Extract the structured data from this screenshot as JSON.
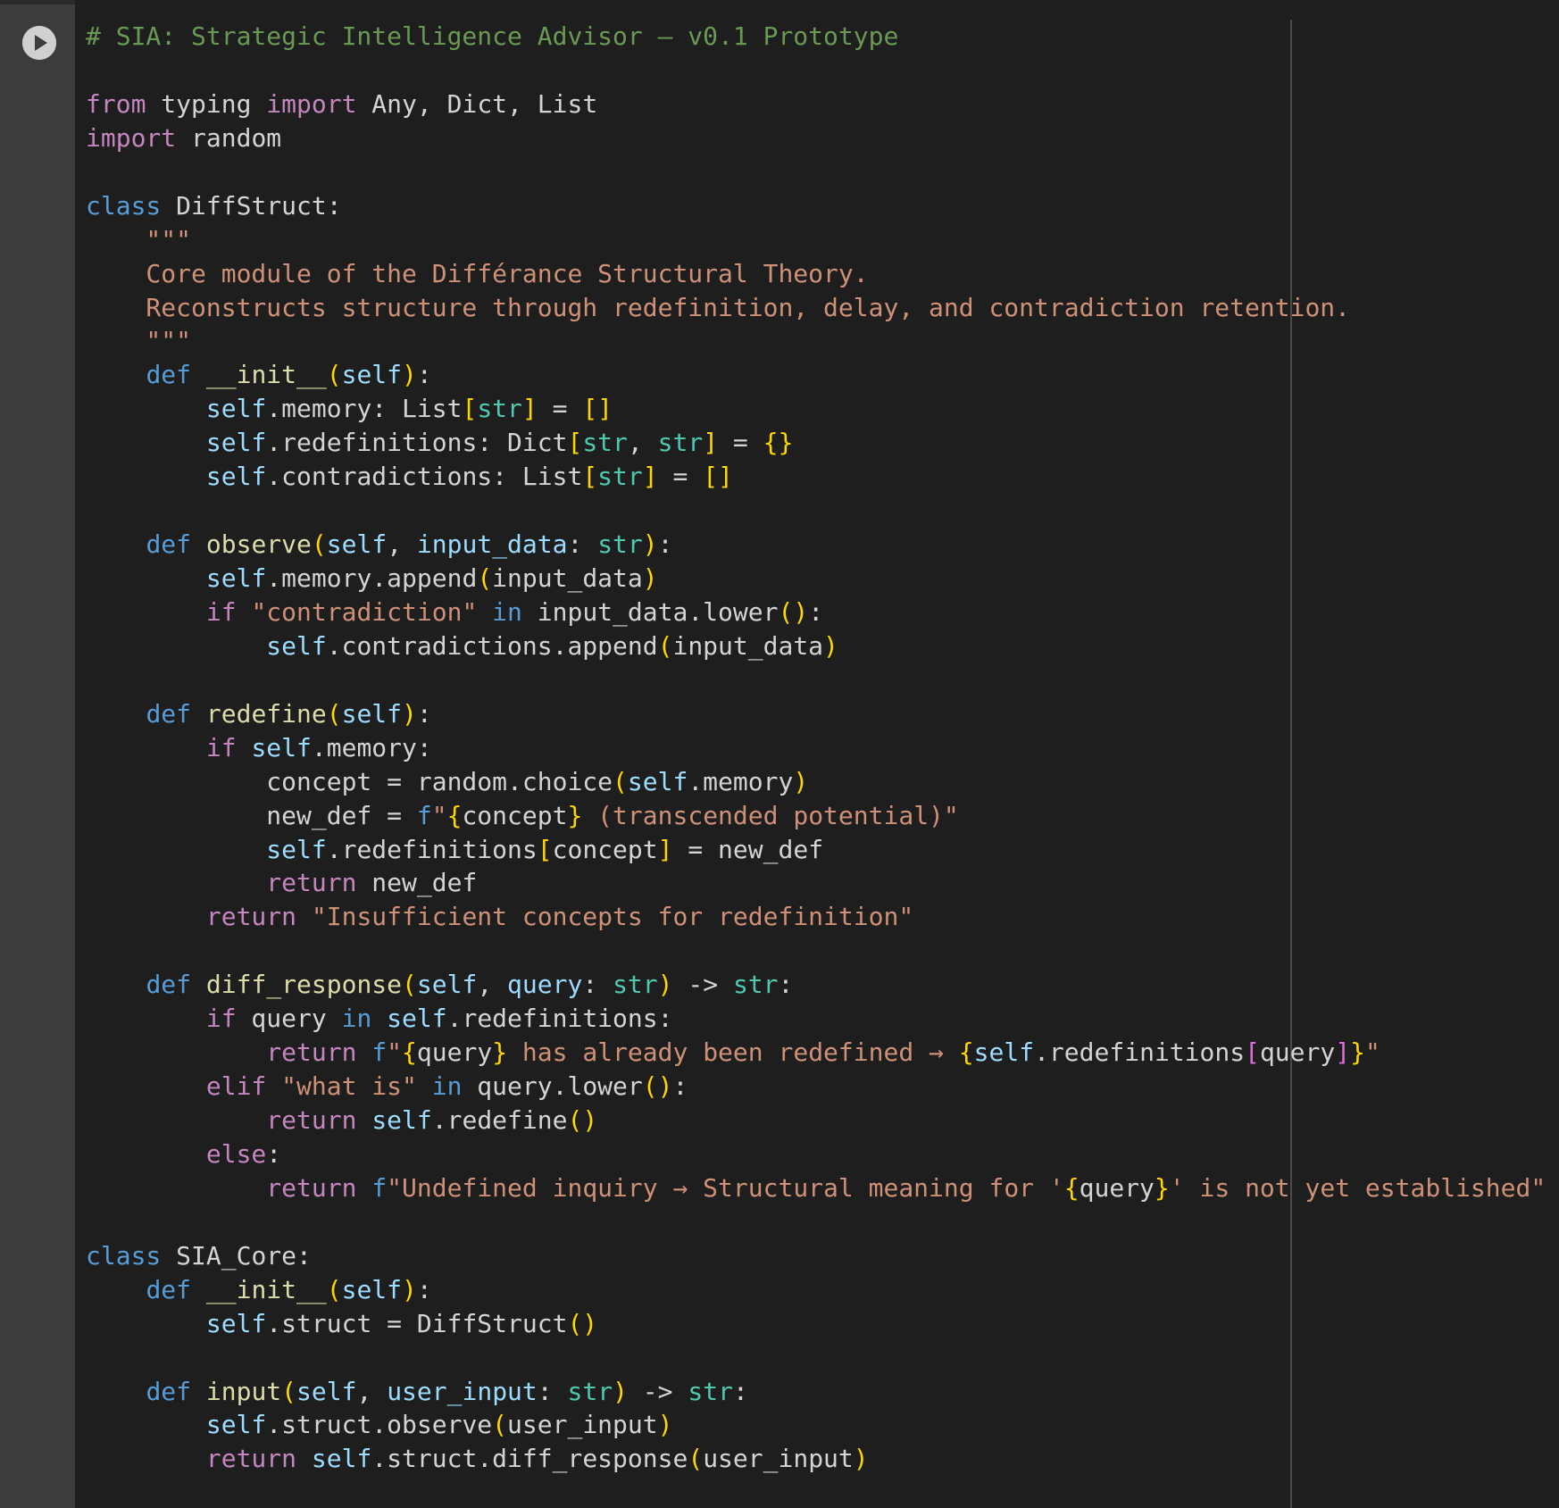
{
  "cell": {
    "run_button_icon": "play-icon",
    "colors": {
      "background": "#1e1e1e",
      "gutter": "#3c3c3c",
      "default_text": "#d4d4d4",
      "comment": "#6a9955",
      "keyword_control": "#c586c0",
      "keyword_decl": "#569cd6",
      "string": "#ce9178",
      "function": "#dcdcaa",
      "builtin_type": "#4ec9b0",
      "variable": "#9cdcfe",
      "bracket": "#ffd700",
      "bracket_nested": "#da70d6",
      "ruler": "#4a4a4a"
    }
  },
  "code_lines": [
    [
      [
        "comment",
        "# SIA: Strategic Intelligence Advisor – v0.1 Prototype"
      ]
    ],
    [],
    [
      [
        "kw",
        "from"
      ],
      [
        "plain",
        " typing "
      ],
      [
        "kw",
        "import"
      ],
      [
        "plain",
        " Any, Dict, List"
      ]
    ],
    [
      [
        "kw",
        "import"
      ],
      [
        "plain",
        " random"
      ]
    ],
    [],
    [
      [
        "decl",
        "class"
      ],
      [
        "plain",
        " DiffStruct:"
      ]
    ],
    [
      [
        "string",
        "    \"\"\""
      ]
    ],
    [
      [
        "string",
        "    Core module of the Différance Structural Theory."
      ]
    ],
    [
      [
        "string",
        "    Reconstructs structure through redefinition, delay, and contradiction retention."
      ]
    ],
    [
      [
        "string",
        "    \"\"\""
      ]
    ],
    [
      [
        "plain",
        "    "
      ],
      [
        "decl",
        "def"
      ],
      [
        "plain",
        " "
      ],
      [
        "func",
        "__init__"
      ],
      [
        "bracket",
        "("
      ],
      [
        "var",
        "self"
      ],
      [
        "bracket",
        ")"
      ],
      [
        "plain",
        ":"
      ]
    ],
    [
      [
        "plain",
        "        "
      ],
      [
        "var",
        "self"
      ],
      [
        "plain",
        ".memory: List"
      ],
      [
        "bracket",
        "["
      ],
      [
        "type",
        "str"
      ],
      [
        "bracket",
        "]"
      ],
      [
        "plain",
        " = "
      ],
      [
        "bracket",
        "[]"
      ]
    ],
    [
      [
        "plain",
        "        "
      ],
      [
        "var",
        "self"
      ],
      [
        "plain",
        ".redefinitions: Dict"
      ],
      [
        "bracket",
        "["
      ],
      [
        "type",
        "str"
      ],
      [
        "plain",
        ", "
      ],
      [
        "type",
        "str"
      ],
      [
        "bracket",
        "]"
      ],
      [
        "plain",
        " = "
      ],
      [
        "bracket",
        "{}"
      ]
    ],
    [
      [
        "plain",
        "        "
      ],
      [
        "var",
        "self"
      ],
      [
        "plain",
        ".contradictions: List"
      ],
      [
        "bracket",
        "["
      ],
      [
        "type",
        "str"
      ],
      [
        "bracket",
        "]"
      ],
      [
        "plain",
        " = "
      ],
      [
        "bracket",
        "[]"
      ]
    ],
    [],
    [
      [
        "plain",
        "    "
      ],
      [
        "decl",
        "def"
      ],
      [
        "plain",
        " "
      ],
      [
        "func",
        "observe"
      ],
      [
        "bracket",
        "("
      ],
      [
        "var",
        "self"
      ],
      [
        "plain",
        ", "
      ],
      [
        "var",
        "input_data"
      ],
      [
        "plain",
        ": "
      ],
      [
        "type",
        "str"
      ],
      [
        "bracket",
        ")"
      ],
      [
        "plain",
        ":"
      ]
    ],
    [
      [
        "plain",
        "        "
      ],
      [
        "var",
        "self"
      ],
      [
        "plain",
        ".memory.append"
      ],
      [
        "bracket",
        "("
      ],
      [
        "plain",
        "input_data"
      ],
      [
        "bracket",
        ")"
      ]
    ],
    [
      [
        "plain",
        "        "
      ],
      [
        "kw",
        "if"
      ],
      [
        "plain",
        " "
      ],
      [
        "string",
        "\"contradiction\""
      ],
      [
        "plain",
        " "
      ],
      [
        "decl",
        "in"
      ],
      [
        "plain",
        " input_data.lower"
      ],
      [
        "bracket",
        "()"
      ],
      [
        "plain",
        ":"
      ]
    ],
    [
      [
        "plain",
        "            "
      ],
      [
        "var",
        "self"
      ],
      [
        "plain",
        ".contradictions.append"
      ],
      [
        "bracket",
        "("
      ],
      [
        "plain",
        "input_data"
      ],
      [
        "bracket",
        ")"
      ]
    ],
    [],
    [
      [
        "plain",
        "    "
      ],
      [
        "decl",
        "def"
      ],
      [
        "plain",
        " "
      ],
      [
        "func",
        "redefine"
      ],
      [
        "bracket",
        "("
      ],
      [
        "var",
        "self"
      ],
      [
        "bracket",
        ")"
      ],
      [
        "plain",
        ":"
      ]
    ],
    [
      [
        "plain",
        "        "
      ],
      [
        "kw",
        "if"
      ],
      [
        "plain",
        " "
      ],
      [
        "var",
        "self"
      ],
      [
        "plain",
        ".memory:"
      ]
    ],
    [
      [
        "plain",
        "            concept = random.choice"
      ],
      [
        "bracket",
        "("
      ],
      [
        "var",
        "self"
      ],
      [
        "plain",
        ".memory"
      ],
      [
        "bracket",
        ")"
      ]
    ],
    [
      [
        "plain",
        "            new_def = "
      ],
      [
        "decl",
        "f"
      ],
      [
        "string",
        "\""
      ],
      [
        "bracket",
        "{"
      ],
      [
        "plain",
        "concept"
      ],
      [
        "bracket",
        "}"
      ],
      [
        "string",
        " (transcended potential)\""
      ]
    ],
    [
      [
        "plain",
        "            "
      ],
      [
        "var",
        "self"
      ],
      [
        "plain",
        ".redefinitions"
      ],
      [
        "bracket",
        "["
      ],
      [
        "plain",
        "concept"
      ],
      [
        "bracket",
        "]"
      ],
      [
        "plain",
        " = new_def"
      ]
    ],
    [
      [
        "plain",
        "            "
      ],
      [
        "kw",
        "return"
      ],
      [
        "plain",
        " new_def"
      ]
    ],
    [
      [
        "plain",
        "        "
      ],
      [
        "kw",
        "return"
      ],
      [
        "plain",
        " "
      ],
      [
        "string",
        "\"Insufficient concepts for redefinition\""
      ]
    ],
    [],
    [
      [
        "plain",
        "    "
      ],
      [
        "decl",
        "def"
      ],
      [
        "plain",
        " "
      ],
      [
        "func",
        "diff_response"
      ],
      [
        "bracket",
        "("
      ],
      [
        "var",
        "self"
      ],
      [
        "plain",
        ", "
      ],
      [
        "var",
        "query"
      ],
      [
        "plain",
        ": "
      ],
      [
        "type",
        "str"
      ],
      [
        "bracket",
        ")"
      ],
      [
        "plain",
        " -> "
      ],
      [
        "type",
        "str"
      ],
      [
        "plain",
        ":"
      ]
    ],
    [
      [
        "plain",
        "        "
      ],
      [
        "kw",
        "if"
      ],
      [
        "plain",
        " query "
      ],
      [
        "decl",
        "in"
      ],
      [
        "plain",
        " "
      ],
      [
        "var",
        "self"
      ],
      [
        "plain",
        ".redefinitions:"
      ]
    ],
    [
      [
        "plain",
        "            "
      ],
      [
        "kw",
        "return"
      ],
      [
        "plain",
        " "
      ],
      [
        "decl",
        "f"
      ],
      [
        "string",
        "\""
      ],
      [
        "bracket",
        "{"
      ],
      [
        "plain",
        "query"
      ],
      [
        "bracket",
        "}"
      ],
      [
        "string",
        " has already been redefined → "
      ],
      [
        "bracket",
        "{"
      ],
      [
        "var",
        "self"
      ],
      [
        "plain",
        ".redefinitions"
      ],
      [
        "bracket2",
        "["
      ],
      [
        "plain",
        "query"
      ],
      [
        "bracket2",
        "]"
      ],
      [
        "bracket",
        "}"
      ],
      [
        "string",
        "\""
      ]
    ],
    [
      [
        "plain",
        "        "
      ],
      [
        "kw",
        "elif"
      ],
      [
        "plain",
        " "
      ],
      [
        "string",
        "\"what is\""
      ],
      [
        "plain",
        " "
      ],
      [
        "decl",
        "in"
      ],
      [
        "plain",
        " query.lower"
      ],
      [
        "bracket",
        "()"
      ],
      [
        "plain",
        ":"
      ]
    ],
    [
      [
        "plain",
        "            "
      ],
      [
        "kw",
        "return"
      ],
      [
        "plain",
        " "
      ],
      [
        "var",
        "self"
      ],
      [
        "plain",
        ".redefine"
      ],
      [
        "bracket",
        "()"
      ]
    ],
    [
      [
        "plain",
        "        "
      ],
      [
        "kw",
        "else"
      ],
      [
        "plain",
        ":"
      ]
    ],
    [
      [
        "plain",
        "            "
      ],
      [
        "kw",
        "return"
      ],
      [
        "plain",
        " "
      ],
      [
        "decl",
        "f"
      ],
      [
        "string",
        "\"Undefined inquiry → Structural meaning for '"
      ],
      [
        "bracket",
        "{"
      ],
      [
        "plain",
        "query"
      ],
      [
        "bracket",
        "}"
      ],
      [
        "string",
        "' is not yet established\""
      ]
    ],
    [],
    [
      [
        "decl",
        "class"
      ],
      [
        "plain",
        " SIA_Core:"
      ]
    ],
    [
      [
        "plain",
        "    "
      ],
      [
        "decl",
        "def"
      ],
      [
        "plain",
        " "
      ],
      [
        "func",
        "__init__"
      ],
      [
        "bracket",
        "("
      ],
      [
        "var",
        "self"
      ],
      [
        "bracket",
        ")"
      ],
      [
        "plain",
        ":"
      ]
    ],
    [
      [
        "plain",
        "        "
      ],
      [
        "var",
        "self"
      ],
      [
        "plain",
        ".struct = DiffStruct"
      ],
      [
        "bracket",
        "()"
      ]
    ],
    [],
    [
      [
        "plain",
        "    "
      ],
      [
        "decl",
        "def"
      ],
      [
        "plain",
        " "
      ],
      [
        "func",
        "input"
      ],
      [
        "bracket",
        "("
      ],
      [
        "var",
        "self"
      ],
      [
        "plain",
        ", "
      ],
      [
        "var",
        "user_input"
      ],
      [
        "plain",
        ": "
      ],
      [
        "type",
        "str"
      ],
      [
        "bracket",
        ")"
      ],
      [
        "plain",
        " -> "
      ],
      [
        "type",
        "str"
      ],
      [
        "plain",
        ":"
      ]
    ],
    [
      [
        "plain",
        "        "
      ],
      [
        "var",
        "self"
      ],
      [
        "plain",
        ".struct.observe"
      ],
      [
        "bracket",
        "("
      ],
      [
        "plain",
        "user_input"
      ],
      [
        "bracket",
        ")"
      ]
    ],
    [
      [
        "plain",
        "        "
      ],
      [
        "kw",
        "return"
      ],
      [
        "plain",
        " "
      ],
      [
        "var",
        "self"
      ],
      [
        "plain",
        ".struct.diff_response"
      ],
      [
        "bracket",
        "("
      ],
      [
        "plain",
        "user_input"
      ],
      [
        "bracket",
        ")"
      ]
    ]
  ]
}
